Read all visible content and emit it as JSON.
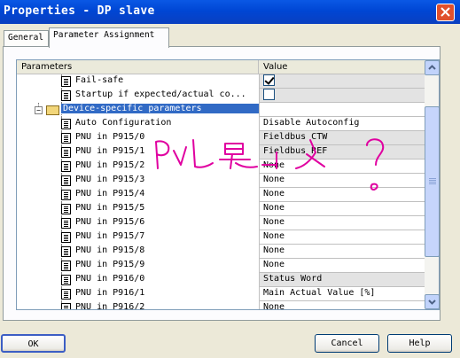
{
  "window": {
    "title": "Properties - DP slave"
  },
  "tabs": [
    {
      "label": "General"
    },
    {
      "label": "Parameter Assignment"
    }
  ],
  "grid": {
    "columns": [
      "Parameters",
      "Value"
    ],
    "rows": [
      {
        "label": "Fail-safe",
        "value": "",
        "check": true,
        "gray": true,
        "level": 2
      },
      {
        "label": "Startup if expected/actual co...",
        "value": "",
        "check": false,
        "gray": true,
        "level": 2
      },
      {
        "label": "Device-specific parameters",
        "value": "",
        "selected": true,
        "gray": false,
        "level": 1,
        "folder": true
      },
      {
        "label": "Auto Configuration",
        "value": "Disable Autoconfig",
        "gray": false,
        "level": 2
      },
      {
        "label": "PNU in P915/0",
        "value": "Fieldbus CTW",
        "gray": true,
        "level": 2
      },
      {
        "label": "PNU in P915/1",
        "value": "Fieldbus REF",
        "gray": true,
        "level": 2
      },
      {
        "label": "PNU in P915/2",
        "value": "None",
        "gray": false,
        "level": 2
      },
      {
        "label": "PNU in P915/3",
        "value": "None",
        "gray": false,
        "level": 2
      },
      {
        "label": "PNU in P915/4",
        "value": "None",
        "gray": false,
        "level": 2
      },
      {
        "label": "PNU in P915/5",
        "value": "None",
        "gray": false,
        "level": 2
      },
      {
        "label": "PNU in P915/6",
        "value": "None",
        "gray": false,
        "level": 2
      },
      {
        "label": "PNU in P915/7",
        "value": "None",
        "gray": false,
        "level": 2
      },
      {
        "label": "PNU in P915/8",
        "value": "None",
        "gray": false,
        "level": 2
      },
      {
        "label": "PNU in P915/9",
        "value": "None",
        "gray": false,
        "level": 2
      },
      {
        "label": "PNU in P916/0",
        "value": "Status Word",
        "gray": true,
        "level": 2
      },
      {
        "label": "PNU in P916/1",
        "value": "Main Actual Value [%]",
        "gray": false,
        "level": 2
      },
      {
        "label": "PNU in P916/2",
        "value": "None",
        "gray": false,
        "level": 2
      }
    ]
  },
  "buttons": {
    "ok": "OK",
    "cancel": "Cancel",
    "help": "Help"
  },
  "colors": {
    "titlebar": "#0046d4",
    "selection": "#316ac5",
    "annotation_ink": "#e000a0"
  }
}
